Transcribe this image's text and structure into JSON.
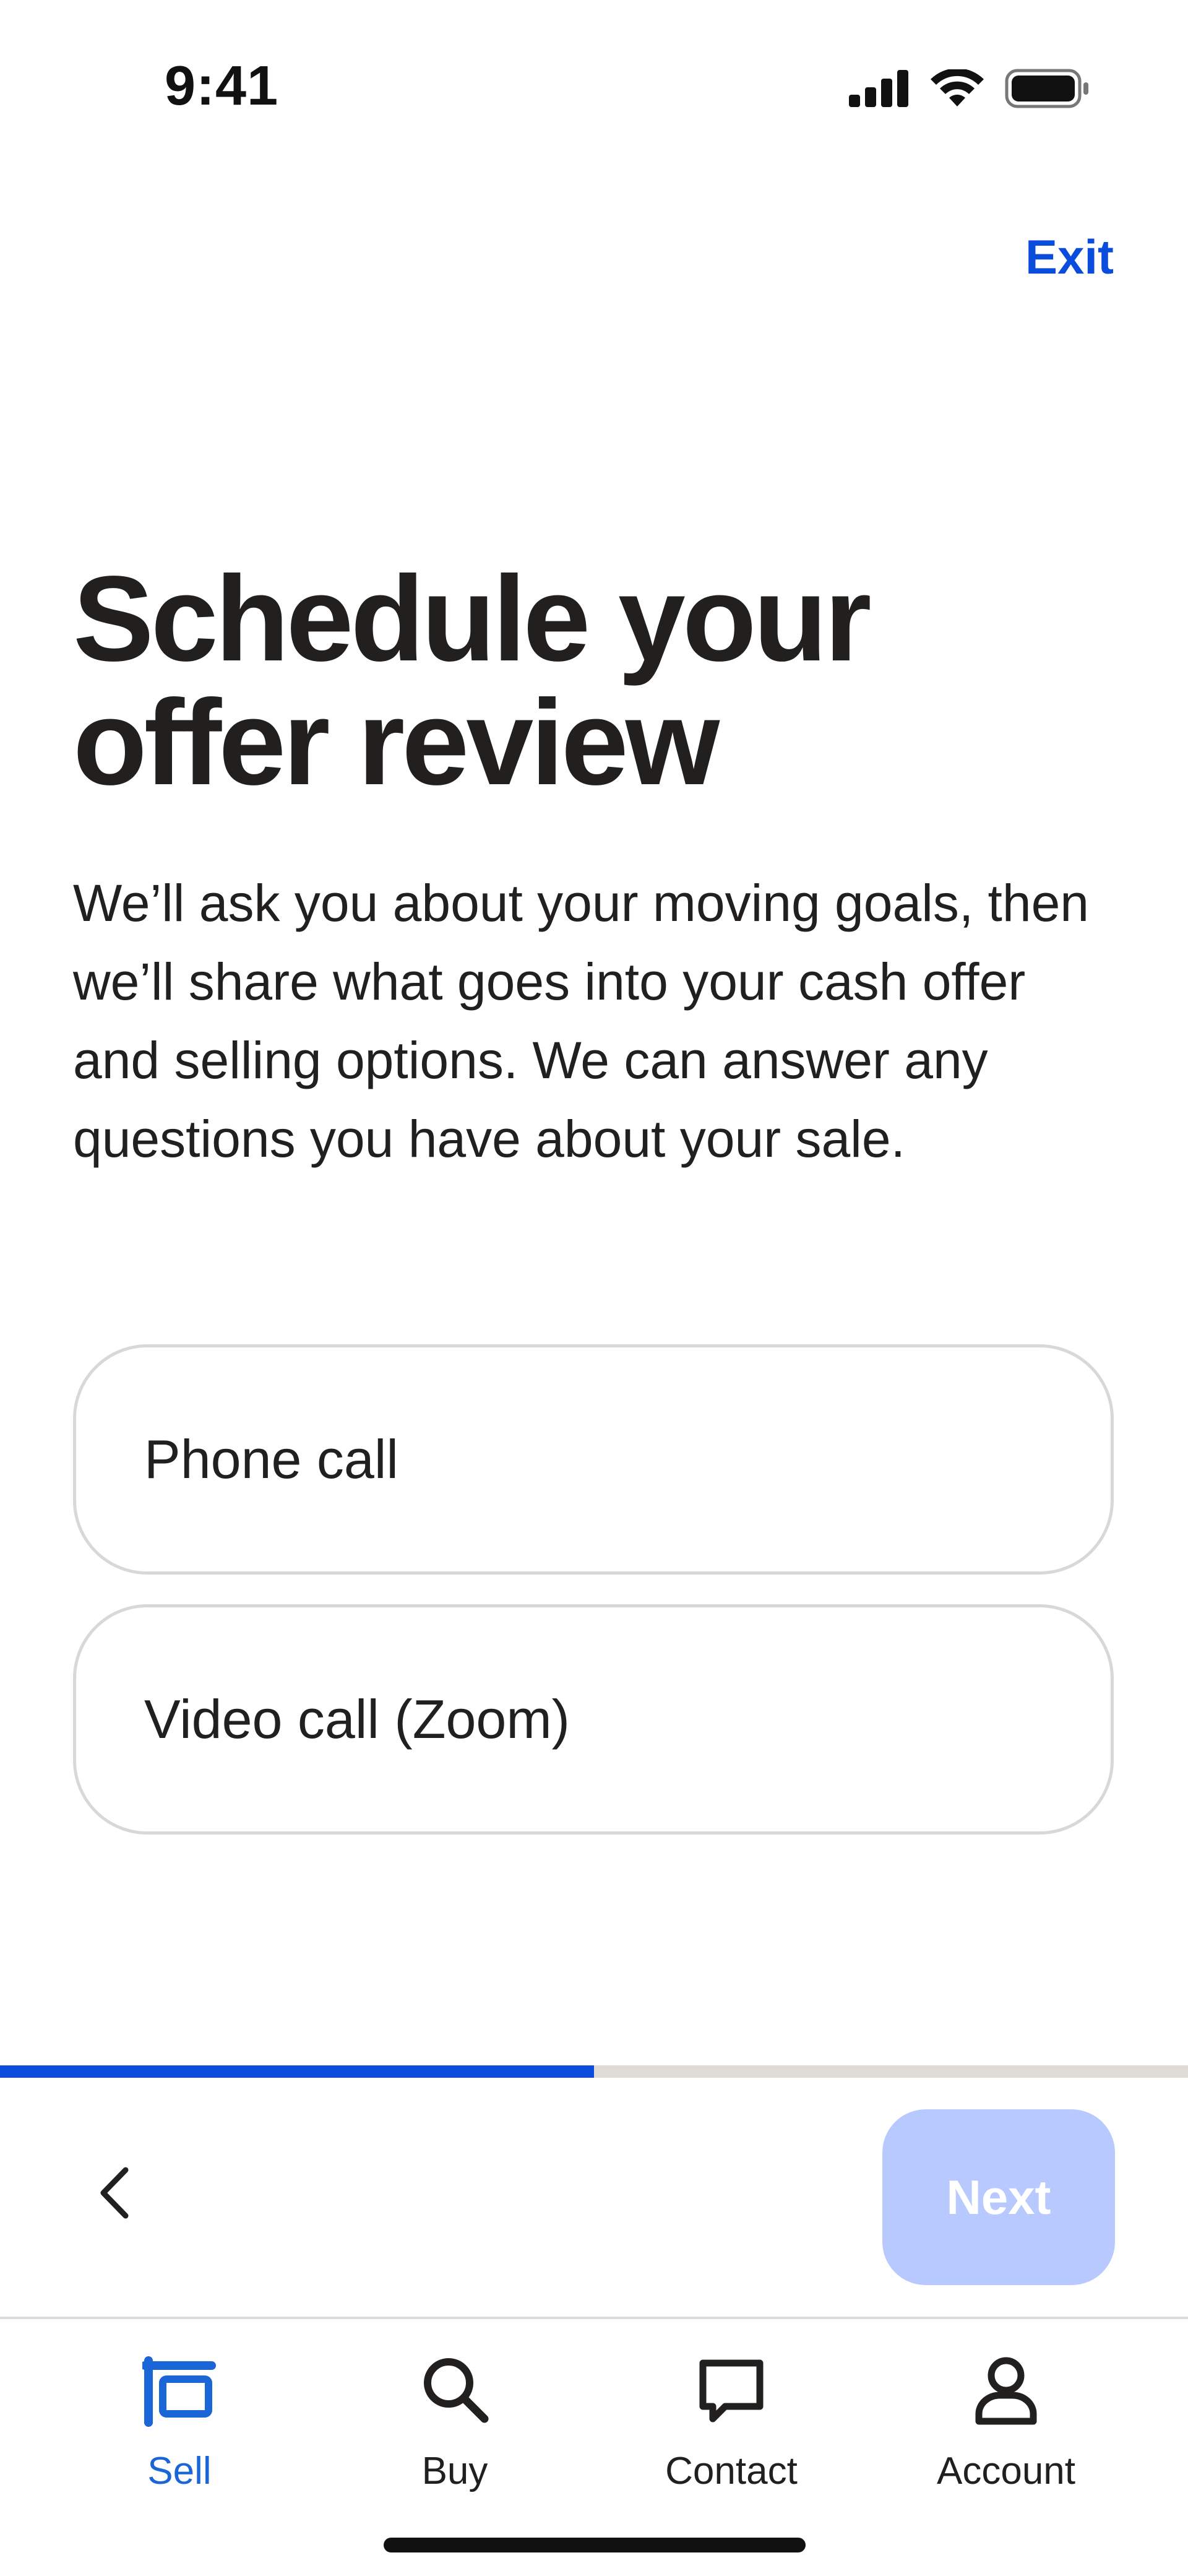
{
  "status_bar": {
    "time": "9:41",
    "icons": [
      "cellular-signal-icon",
      "wifi-icon",
      "battery-icon"
    ]
  },
  "header": {
    "exit_label": "Exit"
  },
  "main": {
    "title": "Schedule your offer review",
    "description": "We’ll ask you about your moving goals, then we’ll share what goes into your cash offer and selling options. We can answer any questions you have about your sale.",
    "options": [
      {
        "label": "Phone call"
      },
      {
        "label": "Video call (Zoom)"
      }
    ]
  },
  "progress": {
    "fraction": 0.5
  },
  "actions": {
    "back_icon": "chevron-left-icon",
    "next_label": "Next",
    "next_enabled": false
  },
  "tab_bar": {
    "active": "Sell",
    "items": [
      {
        "label": "Sell",
        "icon": "sell-sign-icon"
      },
      {
        "label": "Buy",
        "icon": "search-icon"
      },
      {
        "label": "Contact",
        "icon": "chat-bubble-icon"
      },
      {
        "label": "Account",
        "icon": "person-icon"
      }
    ]
  },
  "colors": {
    "accent": "#0a4ddc",
    "active_tab": "#1a66d6",
    "next_disabled": "#b8c9ff",
    "text": "#22201e",
    "border": "#d9d8d6",
    "progress_track": "#dedbd6"
  }
}
